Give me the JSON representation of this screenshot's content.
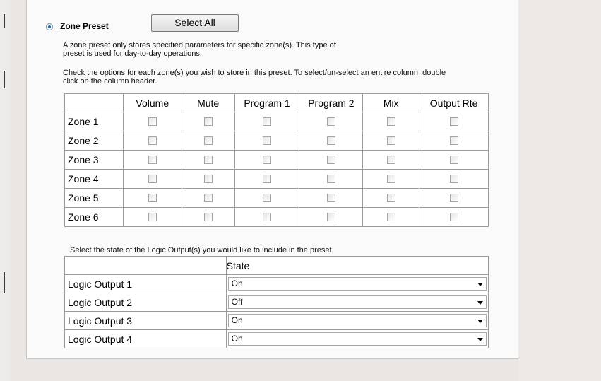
{
  "preset": {
    "radio_selected": true,
    "title": "Zone Preset",
    "select_all_label": "Select All",
    "desc1_line1": "A zone preset only stores specified parameters for specific zone(s).  This type of",
    "desc1_line2": "preset is used for day-to-day operations.",
    "desc2_line1": "Check the options for each zone(s) you wish to store in this preset. To select/un-select an entire column, double",
    "desc2_line2": "click on the column header."
  },
  "zone_table": {
    "columns": [
      "",
      "Volume",
      "Mute",
      "Program 1",
      "Program 2",
      "Mix",
      "Output Rte"
    ],
    "rows": [
      "Zone 1",
      "Zone 2",
      "Zone 3",
      "Zone 4",
      "Zone 5",
      "Zone 6"
    ]
  },
  "logic": {
    "instruction": "Select the state of the Logic Output(s) you would like to include in the preset.",
    "state_header": "State",
    "outputs": [
      {
        "label": "Logic Output 1",
        "state": "On"
      },
      {
        "label": "Logic Output 2",
        "state": "Off"
      },
      {
        "label": "Logic Output 3",
        "state": "On"
      },
      {
        "label": "Logic Output 4",
        "state": "On"
      }
    ]
  }
}
